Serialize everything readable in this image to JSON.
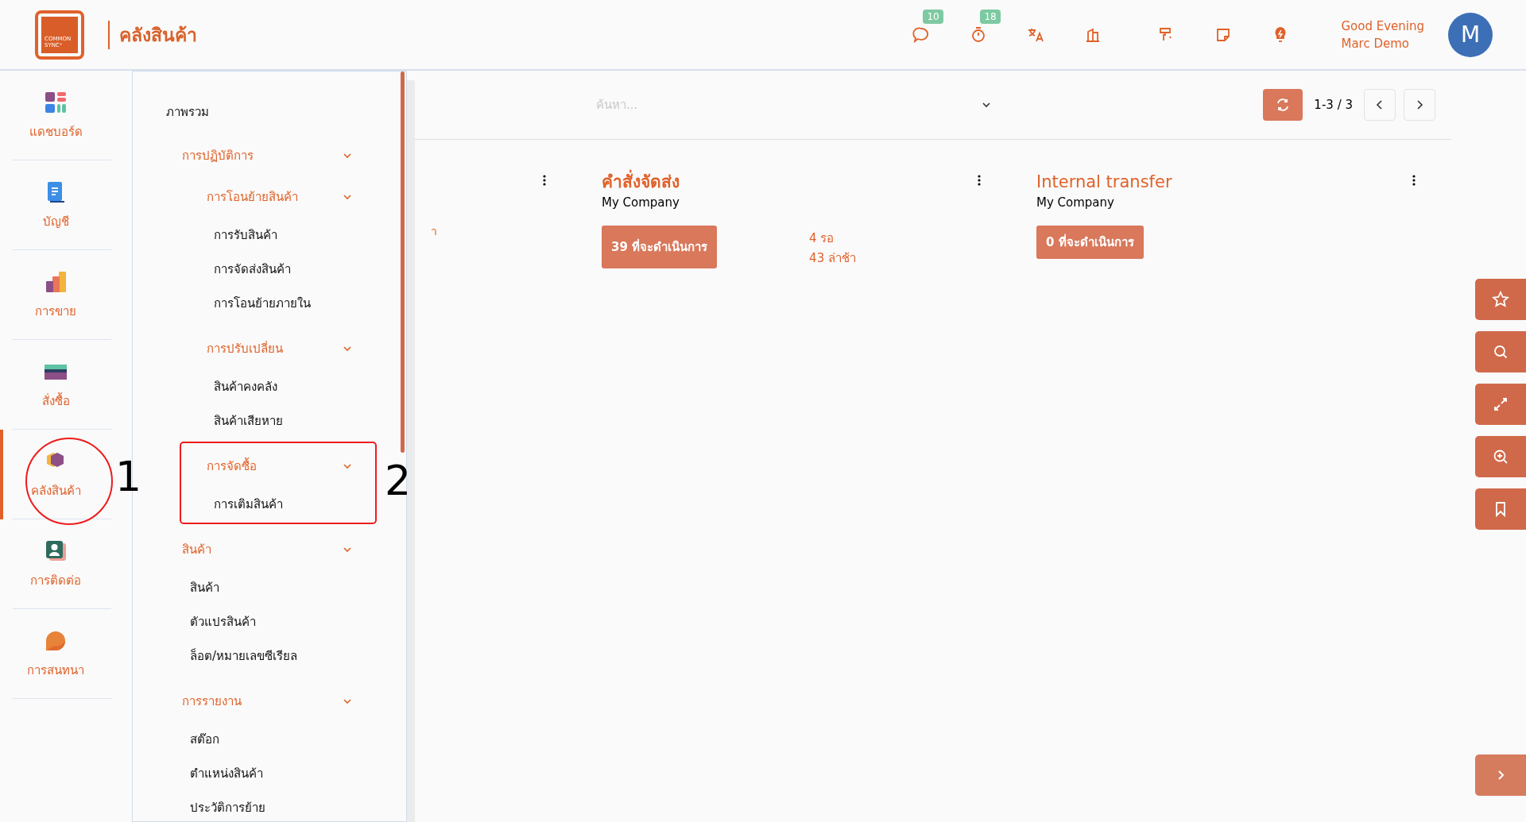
{
  "header": {
    "logo_text": [
      "COMMON",
      "SYNC⁺"
    ],
    "title": "คลังสินค้า",
    "icon_counts": [
      "10",
      "18"
    ],
    "greeting": "Good Evening",
    "user_name": "Marc Demo",
    "avatar_letter": "M"
  },
  "sidebar": {
    "items": [
      {
        "label": "แดชบอร์ด",
        "selected": false
      },
      {
        "label": "บัญชี",
        "selected": false
      },
      {
        "label": "การขาย",
        "selected": false
      },
      {
        "label": "สั่งซื้อ",
        "selected": false
      },
      {
        "label": "คลังสินค้า",
        "selected": true
      },
      {
        "label": "การติดต่อ",
        "selected": false
      },
      {
        "label": "การสนทนา",
        "selected": false
      }
    ]
  },
  "menu": [
    {
      "label": "ภาพรวม"
    },
    {
      "label": "การปฏิบัติการ",
      "expanded": true,
      "children": [
        {
          "label": "การโอนย้ายสินค้า",
          "expanded": true,
          "children": [
            {
              "label": "การรับสินค้า"
            },
            {
              "label": "การจัดส่งสินค้า"
            },
            {
              "label": "การโอนย้ายภายใน"
            }
          ]
        },
        {
          "label": "การปรับเปลี่ยน",
          "expanded": true,
          "children": [
            {
              "label": "สินค้าคงคลัง"
            },
            {
              "label": "สินค้าเสียหาย"
            }
          ]
        },
        {
          "label": "การจัดซื้อ",
          "expanded": true,
          "children": [
            {
              "label": "การเติมสินค้า"
            }
          ]
        }
      ]
    },
    {
      "label": "สินค้า",
      "expanded": true,
      "children": [
        {
          "label": "สินค้า"
        },
        {
          "label": "ตัวแปรสินค้า"
        },
        {
          "label": "ล็อต/หมายเลขซีเรียล"
        }
      ]
    },
    {
      "label": "การรายงาน",
      "expanded": true,
      "children": [
        {
          "label": "สต๊อก"
        },
        {
          "label": "ตำแหน่งสินค้า"
        },
        {
          "label": "ประวัติการย้าย"
        }
      ]
    }
  ],
  "search": {
    "placeholder": "ค้นหา..."
  },
  "pager": {
    "range": "1-3 / 3"
  },
  "hidden_card": {
    "text_fragment": "า"
  },
  "cards": [
    {
      "title": "คำสั่งจัดส่ง",
      "company": "My Company",
      "action": "39 ที่จะดำเนินการ",
      "stats": [
        "4 รอ",
        "43 ล่าช้า"
      ]
    },
    {
      "title": "Internal transfer",
      "company": "My Company",
      "action": "0 ที่จะดำเนินการ"
    }
  ],
  "annotations": [
    {
      "label": "1",
      "kind": "circle"
    },
    {
      "label": "2",
      "kind": "rect"
    }
  ]
}
